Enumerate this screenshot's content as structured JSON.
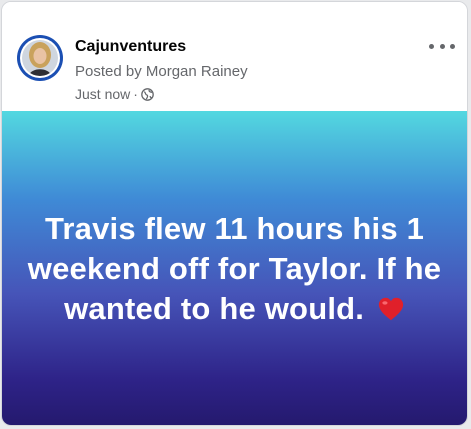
{
  "post": {
    "page_name": "Cajunventures",
    "posted_by": "Posted by Morgan Rainey",
    "time": "Just now",
    "separator": "·",
    "privacy_icon": "globe-icon",
    "more_icon": "more-options-icon",
    "text": "Travis flew 11 hours his 1 weekend off for Taylor. If he wanted to he would.",
    "emoji": "heart-icon"
  },
  "colors": {
    "avatar_ring": "#1b4fb3",
    "gradient_top": "#53d8e0",
    "gradient_bottom": "#24196d",
    "heart": "#e0202a"
  }
}
